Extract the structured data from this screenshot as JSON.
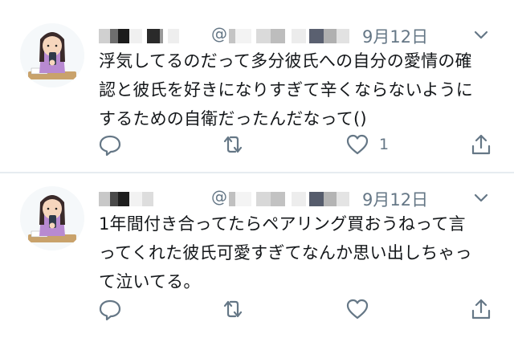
{
  "tweets": [
    {
      "at_symbol": "@",
      "date": "9月12日",
      "text": "浮気してるのだって多分彼氏への自分の愛情の確\n認と彼氏を好きになりすぎて辛くならないように\nするための自衛だったんだなって()",
      "reply_icon": "reply-icon",
      "retweet_icon": "retweet-icon",
      "like_icon": "heart-icon",
      "like_count": "1",
      "share_icon": "share-icon",
      "menu_icon": "chevron-down-icon"
    },
    {
      "at_symbol": "@",
      "date": "9月12日",
      "text": "1年間付き合ってたらペアリング買おうねって言\nってくれた彼氏可愛すぎてなんか思い出しちゃっ\nて泣いてる。",
      "reply_icon": "reply-icon",
      "retweet_icon": "retweet-icon",
      "like_icon": "heart-icon",
      "like_count": "",
      "share_icon": "share-icon",
      "menu_icon": "chevron-down-icon"
    }
  ],
  "colors": {
    "text": "#14171a",
    "secondary": "#657786",
    "divider": "#e6ecf0"
  }
}
